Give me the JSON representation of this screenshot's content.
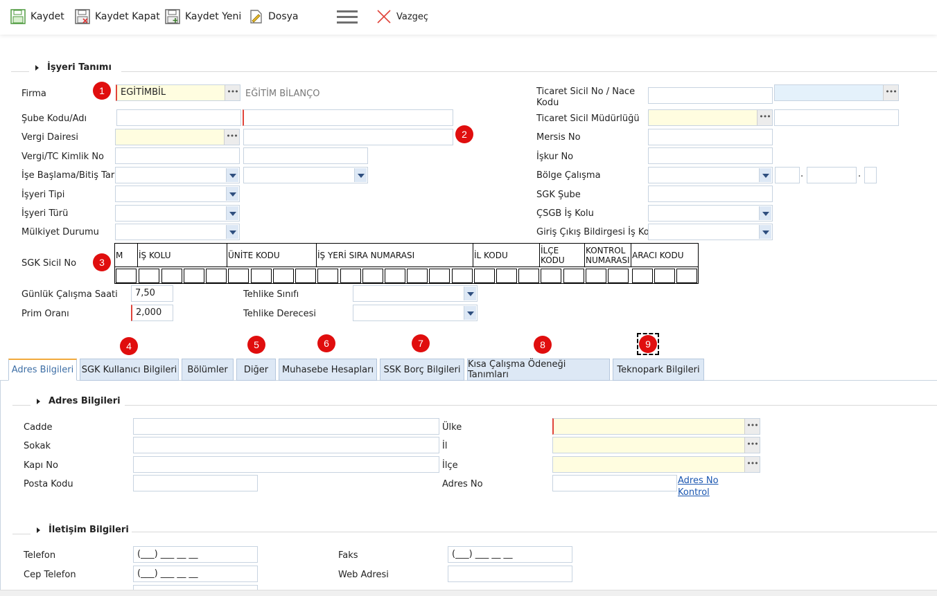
{
  "toolbar": {
    "kaydet": "Kaydet",
    "kaydet_kapat": "Kaydet Kapat",
    "kaydet_yeni": "Kaydet Yeni",
    "dosya": "Dosya",
    "vazgec": "Vazgeç"
  },
  "section1": {
    "title": "İşyeri Tanımı",
    "firma_label": "Firma",
    "firma_value": "EGİTİMBİL",
    "firma_desc": "EĞİTİM BİLANÇO",
    "sube_label": "Şube Kodu/Adı",
    "vergi_dairesi_label": "Vergi Dairesi",
    "vergi_no_label": "Vergi/TC Kimlik No",
    "ise_baslama_label": "İşe Başlama/Bitiş Tarihi",
    "isyeri_tipi_label": "İşyeri Tipi",
    "isyeri_turu_label": "İşyeri Türü",
    "mulkiyet_label": "Mülkiyet Durumu",
    "ticaret_sicil_label_1": "Ticaret Sicil No / Nace",
    "ticaret_sicil_label_2": "Kodu",
    "ticaret_mudurlugu_label": "Ticaret Sicil Müdürlüğü",
    "mersis_label": "Mersis No",
    "iskur_label": "İşkur No",
    "bolge_label": "Bölge Çalışma",
    "sgk_sube_label": "SGK Şube",
    "csgb_label": "ÇSGB İş Kolu",
    "giris_cikis_label": "Giriş Çıkış Bildirgesi İş Kolu",
    "sgk_sicil_label": "SGK Sicil No",
    "gunluk_label": "Günlük Çalışma Saati",
    "gunluk_value": "7,50",
    "prim_label": "Prim Oranı",
    "prim_value": "2,000",
    "tehlike_sinifi_label": "Tehlike Sınıfı",
    "tehlike_derecesi_label": "Tehlike Derecesi",
    "dot": "."
  },
  "sgk_headers": [
    "M",
    "İŞ KOLU",
    "ÜNİTE KODU",
    "İŞ YERİ SIRA NUMARASI",
    "İL KODU",
    "İLÇE KODU",
    "KONTROL NUMARASI",
    "ARACI KODU"
  ],
  "badges": [
    "1",
    "2",
    "3",
    "4",
    "5",
    "6",
    "7",
    "8",
    "9"
  ],
  "tabs": [
    "Adres Bilgileri",
    "SGK Kullanıcı Bilgileri",
    "Bölümler",
    "Diğer",
    "Muhasebe Hesapları",
    "SSK Borç Bilgileri",
    "Kısa Çalışma Ödeneği Tanımları",
    "Teknopark Bilgileri"
  ],
  "adres": {
    "title": "Adres Bilgileri",
    "cadde": "Cadde",
    "sokak": "Sokak",
    "kapi_no": "Kapı No",
    "posta_kodu": "Posta Kodu",
    "ulke": "Ülke",
    "il": "İl",
    "ilce": "İlçe",
    "adres_no": "Adres No",
    "adres_no_link_1": "Adres No",
    "adres_no_link_2": "Kontrol"
  },
  "iletisim": {
    "title": "İletişim Bilgileri",
    "telefon": "Telefon",
    "cep": "Cep Telefon",
    "faks": "Faks",
    "web": "Web Adresi",
    "phone_mask": "(___) ___ __ __"
  }
}
